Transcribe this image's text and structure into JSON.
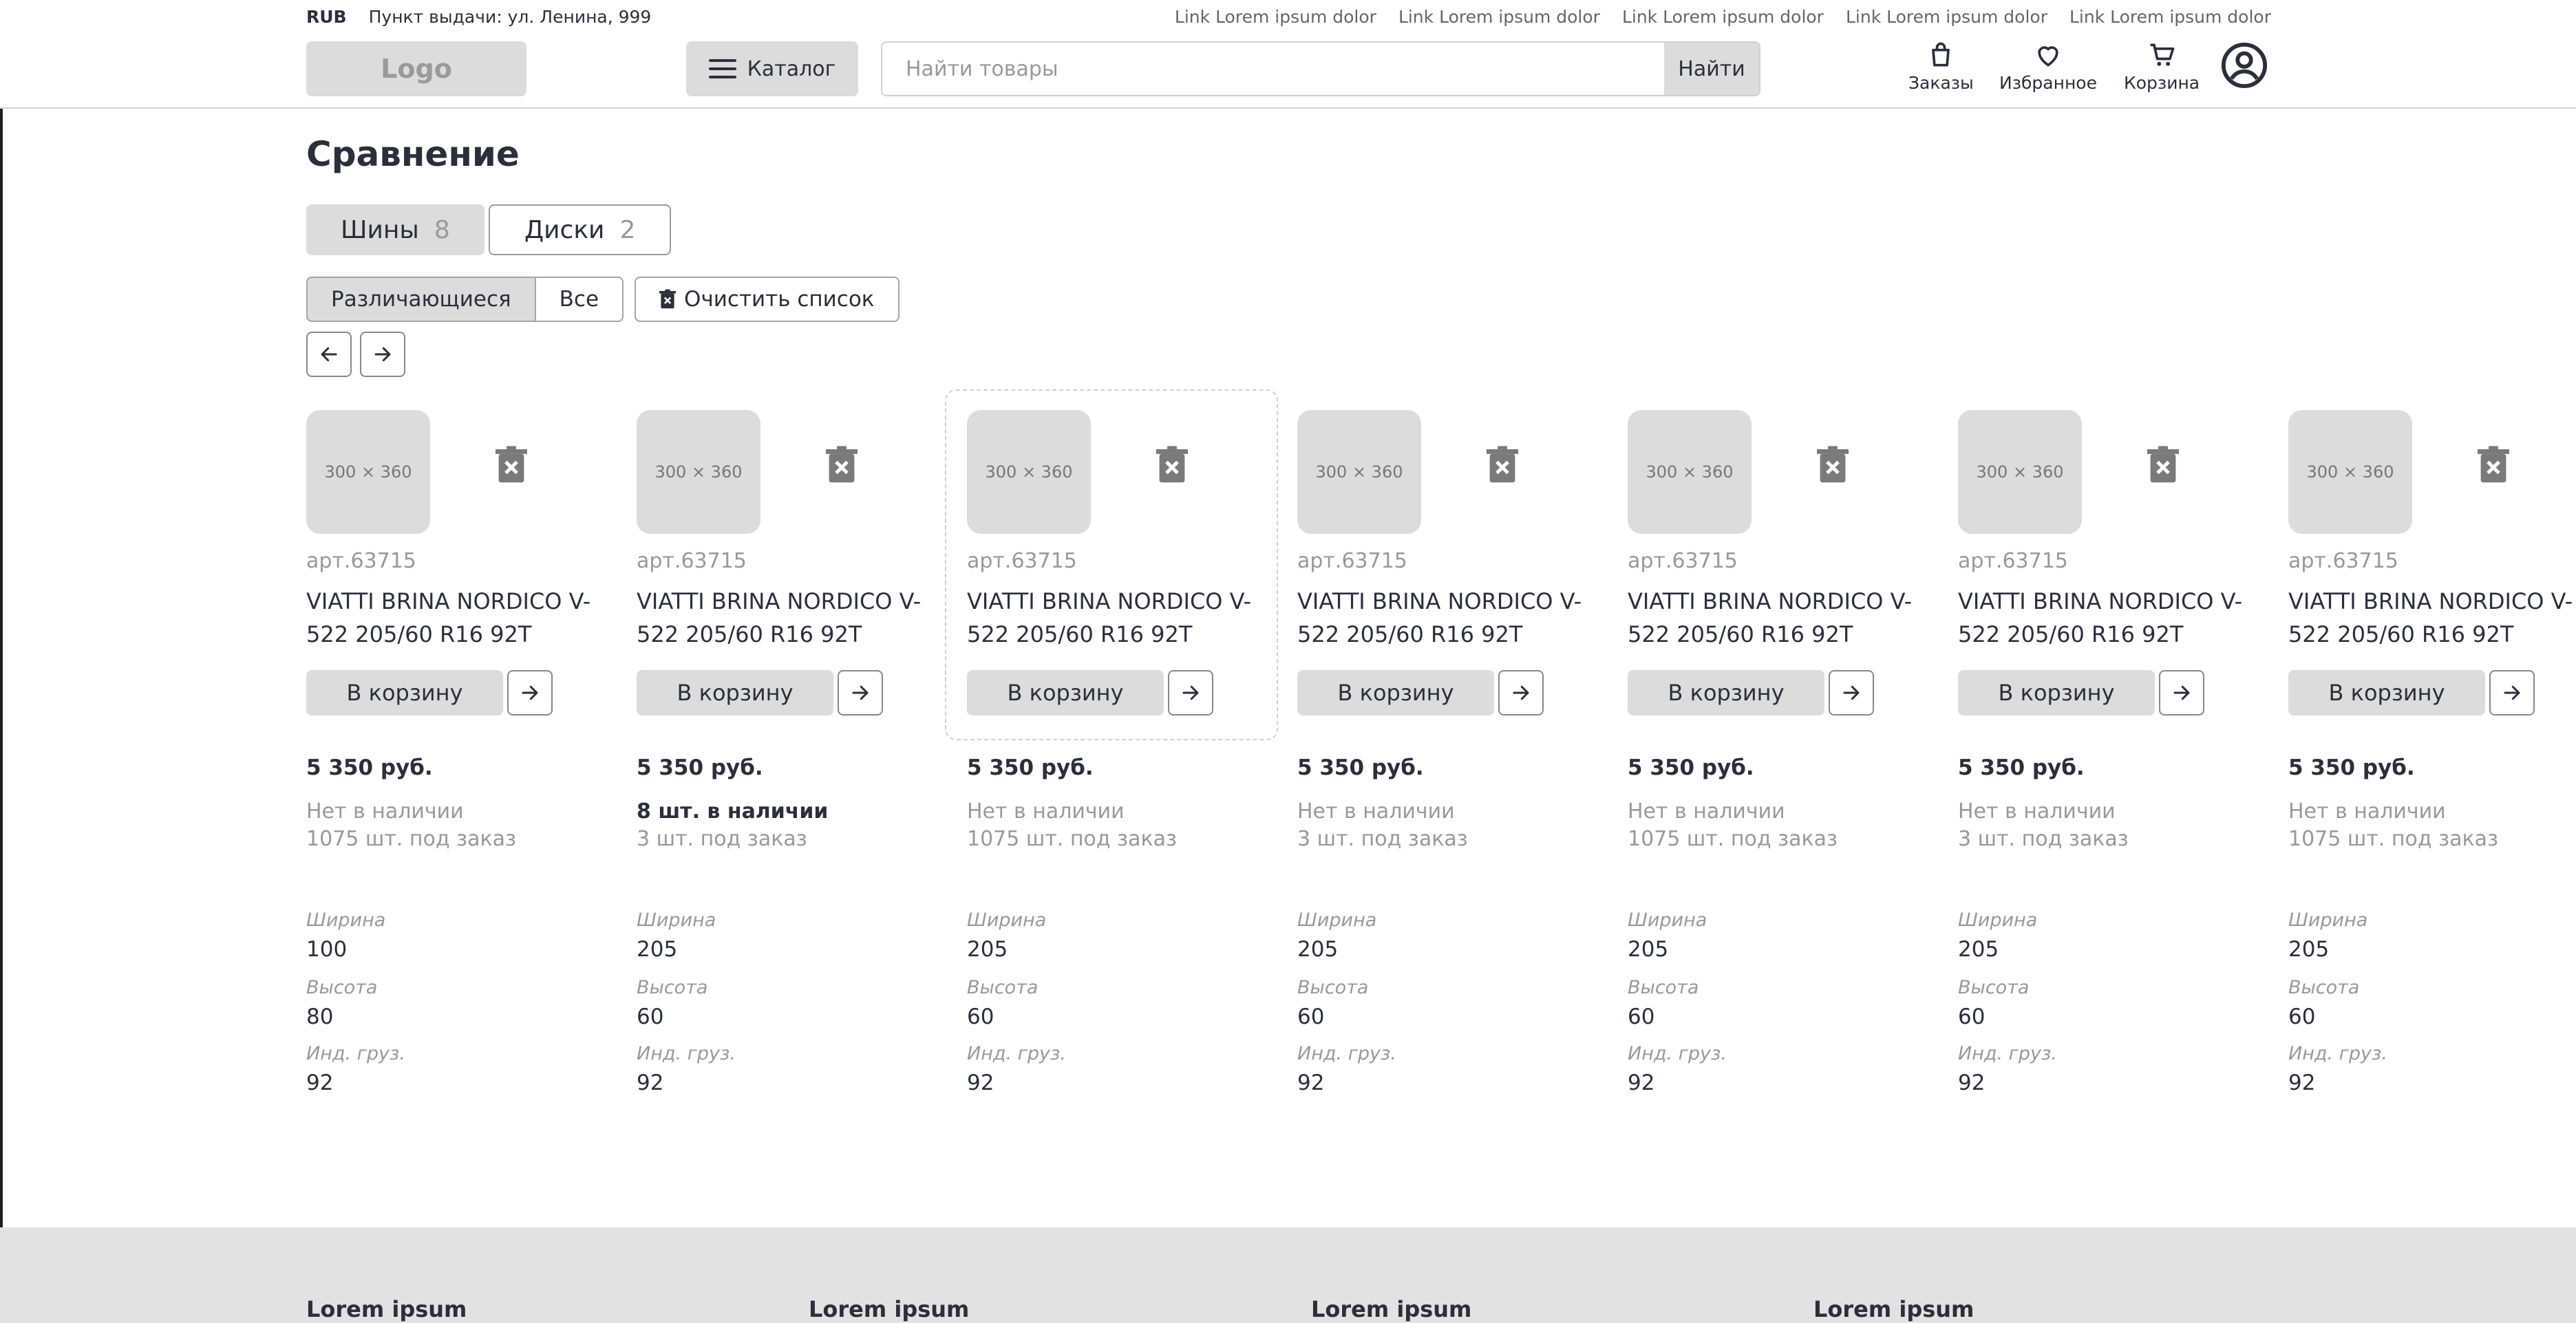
{
  "header": {
    "currency": "RUB",
    "pickup": "Пункт выдачи: ул. Ленина, 999",
    "links": [
      "Link Lorem ipsum dolor",
      "Link Lorem ipsum dolor",
      "Link Lorem ipsum dolor",
      "Link Lorem ipsum dolor",
      "Link Lorem ipsum dolor"
    ],
    "logo": "Logo",
    "catalog": "Каталог",
    "search_placeholder": "Найти товары",
    "search_button": "Найти",
    "orders": "Заказы",
    "favorites": "Избранное",
    "cart": "Корзина"
  },
  "page": {
    "title": "Сравнение",
    "tabs": [
      {
        "label": "Шины",
        "count": "8"
      },
      {
        "label": "Диски",
        "count": "2"
      }
    ],
    "filter_diff": "Различающиеся",
    "filter_all": "Все",
    "clear": "Очистить список"
  },
  "products": [
    {
      "thumb": "300 × 360",
      "art": "арт.63715",
      "name": "VIATTI BRINA NORDICO V-522 205/60 R16 92T",
      "cart": "В корзину",
      "price": "5 350 руб.",
      "availability": "Нет в наличии",
      "order": "1075 шт. под заказ",
      "width": "100",
      "height": "80",
      "load": "92"
    },
    {
      "thumb": "300 × 360",
      "art": "арт.63715",
      "name": "VIATTI BRINA NORDICO V-522 205/60 R16 92T",
      "cart": "В корзину",
      "price": "5 350 руб.",
      "availability": "8 шт. в наличии",
      "order": "3 шт. под заказ",
      "width": "205",
      "height": "60",
      "load": "92"
    },
    {
      "thumb": "300 × 360",
      "art": "арт.63715",
      "name": "VIATTI BRINA NORDICO V-522 205/60 R16 92T",
      "cart": "В корзину",
      "price": "5 350 руб.",
      "availability": "Нет в наличии",
      "order": "1075 шт. под заказ",
      "width": "205",
      "height": "60",
      "load": "92"
    },
    {
      "thumb": "300 × 360",
      "art": "арт.63715",
      "name": "VIATTI BRINA NORDICO V-522 205/60 R16 92T",
      "cart": "В корзину",
      "price": "5 350 руб.",
      "availability": "Нет в наличии",
      "order": "3 шт. под заказ",
      "width": "205",
      "height": "60",
      "load": "92"
    },
    {
      "thumb": "300 × 360",
      "art": "арт.63715",
      "name": "VIATTI BRINA NORDICO V-522 205/60 R16 92T",
      "cart": "В корзину",
      "price": "5 350 руб.",
      "availability": "Нет в наличии",
      "order": "1075 шт. под заказ",
      "width": "205",
      "height": "60",
      "load": "92"
    },
    {
      "thumb": "300 × 360",
      "art": "арт.63715",
      "name": "VIATTI BRINA NORDICO V-522 205/60 R16 92T",
      "cart": "В корзину",
      "price": "5 350 руб.",
      "availability": "Нет в наличии",
      "order": "3 шт. под заказ",
      "width": "205",
      "height": "60",
      "load": "92"
    },
    {
      "thumb": "300 × 360",
      "art": "арт.63715",
      "name": "VIATTI BRINA NORDICO V-522 205/60 R16 92T",
      "cart": "В корзину",
      "price": "5 350 руб.",
      "availability": "Нет в наличии",
      "order": "1075 шт. под заказ",
      "width": "205",
      "height": "60",
      "load": "92"
    }
  ],
  "param_labels": {
    "width": "Ширина",
    "height": "Высота",
    "load": "Инд. груз."
  },
  "footer": {
    "columns": [
      "Lorem ipsum",
      "Lorem ipsum",
      "Lorem ipsum",
      "Lorem ipsum"
    ]
  }
}
